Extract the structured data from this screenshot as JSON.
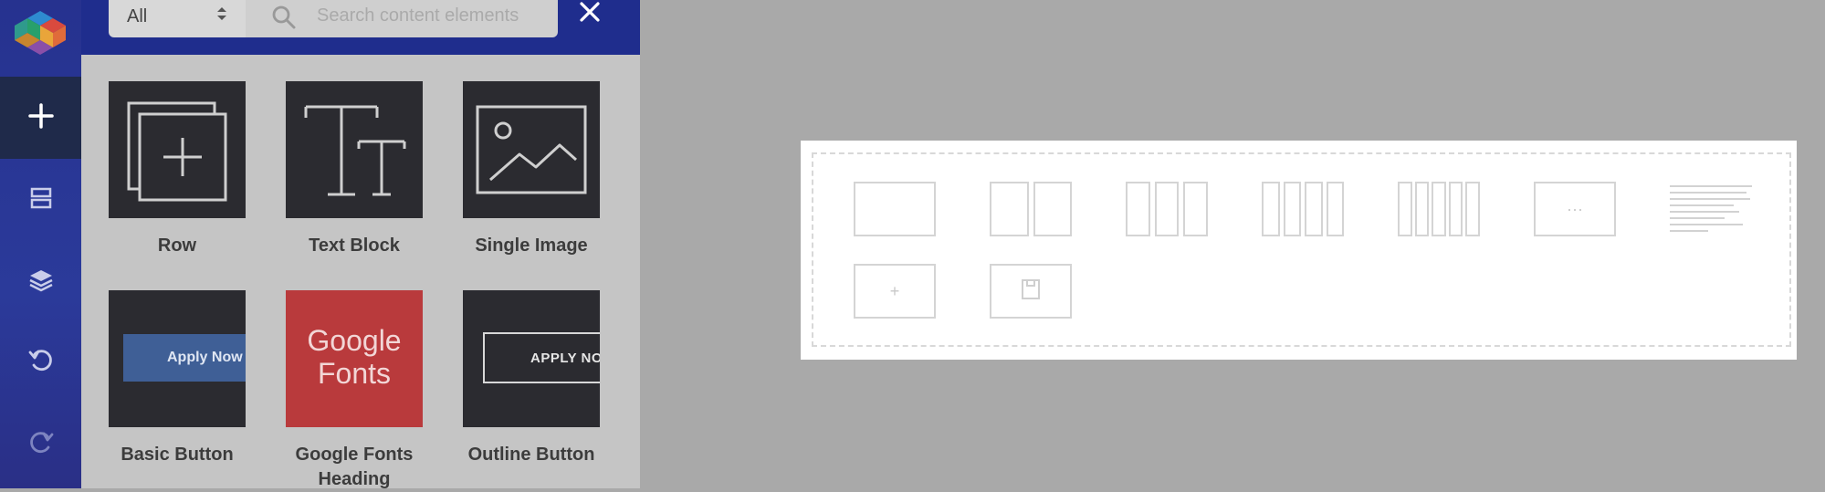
{
  "panel": {
    "filter_value": "All",
    "search_placeholder": "Search content elements"
  },
  "sidebar": {
    "items": [
      {
        "icon": "plus-icon",
        "active": true
      },
      {
        "icon": "layout-icon"
      },
      {
        "icon": "layers-icon"
      },
      {
        "icon": "undo-icon"
      },
      {
        "icon": "redo-icon"
      }
    ]
  },
  "elements": [
    {
      "label": "Row",
      "icon": "row-icon"
    },
    {
      "label": "Text Block",
      "icon": "text-block-icon"
    },
    {
      "label": "Single Image",
      "icon": "single-image-icon"
    },
    {
      "label": "Basic Button",
      "icon": "basic-button-preview",
      "preview_text": "Apply Now"
    },
    {
      "label": "Google Fonts Heading",
      "icon": "google-fonts-preview",
      "preview_text_1": "Google",
      "preview_text_2": "Fonts"
    },
    {
      "label": "Outline Button",
      "icon": "outline-button-preview",
      "preview_text": "APPLY NO"
    }
  ],
  "canvas": {
    "layouts": [
      "1 column",
      "2 columns",
      "3 columns",
      "4 columns",
      "5 columns",
      "custom",
      "text block"
    ],
    "custom_label": "···",
    "add_label": "+"
  },
  "colors": {
    "sidebar": "#26328f",
    "header": "#1f2d8d",
    "panel": "#c5c5c5",
    "tile": "#2b2b30",
    "google_fonts": "#b93a3c",
    "basic_button": "#3f5f96"
  }
}
